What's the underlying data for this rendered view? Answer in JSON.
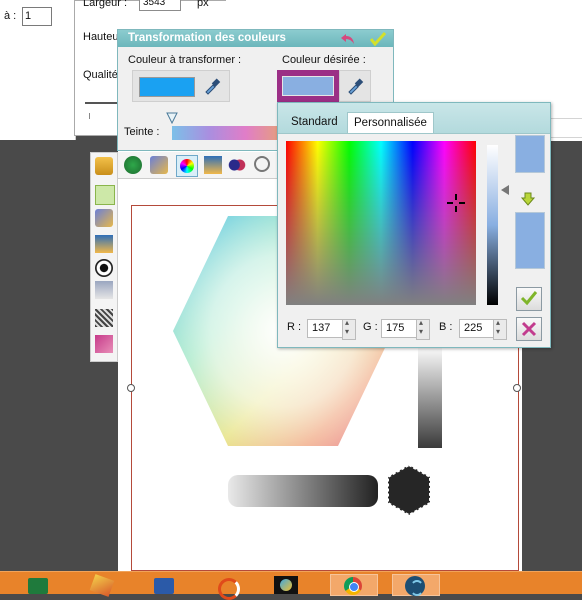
{
  "background": {
    "left_panel_label": "à :",
    "left_panel_value": "1",
    "resize": {
      "largeur_label": "Largeur :",
      "largeur_value": "3543",
      "largeur_unit": "px",
      "hauteur_label": "Hauteur",
      "qualite_label": "Qualité"
    }
  },
  "dialog": {
    "title": "Transformation des couleurs",
    "source_label": "Couleur à transformer :",
    "target_label": "Couleur désirée :",
    "hue_label": "Teinte :",
    "source_color": "#1aa1f2",
    "target_color": "#89afe1",
    "icons": {
      "undo": "undo-arrow-icon",
      "ok": "checkmark-icon",
      "dropper": "eyedropper-icon"
    }
  },
  "picker": {
    "tabs": [
      "Standard",
      "Personnalisée"
    ],
    "active_tab": "Personnalisée",
    "r_label": "R :",
    "r_value": "137",
    "g_label": "G :",
    "g_value": "175",
    "b_label": "B :",
    "b_value": "225",
    "old_color": "#89afe1",
    "new_color": "#89afe1",
    "icons": {
      "ok": "checkmark-icon",
      "cancel": "close-x-icon",
      "transfer": "down-arrow-icon"
    }
  },
  "taskbar": {
    "apps": [
      "excel-icon",
      "office-app-icon",
      "word-icon",
      "office-circle-icon",
      "paint-icon",
      "chrome-icon",
      "snagit-icon"
    ]
  }
}
